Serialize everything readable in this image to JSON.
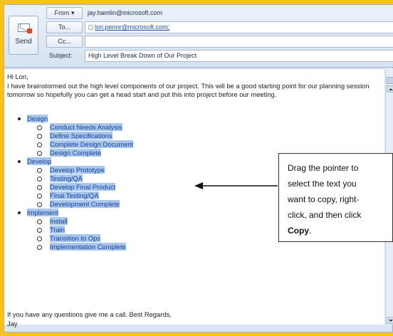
{
  "header": {
    "send_label": "Send",
    "from_label": "From ▾",
    "from_value": "jay.hamlin@microsoft.com",
    "to_label": "To...",
    "to_value": "lori.penor@microsoft.com;",
    "cc_label": "Cc...",
    "cc_value": "",
    "subject_label": "Subject:",
    "subject_value": "High Level Break Down of Our Project"
  },
  "message": {
    "greeting": "Hi Lori,",
    "intro": "I have brainstormed out the high level components of our project.  This will be a good starting point for our planning session tomorrow so hopefully you can get a head start and put this into project before our meeting.",
    "sections": [
      {
        "title": "Design",
        "items": [
          "Conduct Needs Analysis",
          "Define Specifications",
          "Complete Design Document",
          "Design Complete"
        ]
      },
      {
        "title": "Develop",
        "items": [
          "Develop Prototype",
          "Testing/QA",
          "Develop Final Product",
          "Final Testing/QA",
          "Development Complete"
        ]
      },
      {
        "title": "Implement",
        "items": [
          "Install",
          "Train",
          "Transition to Ops",
          "Implementation Complete"
        ]
      }
    ],
    "closing": "If you have any questions give me a call.  Best Regards,",
    "signature": "Jay"
  },
  "callout": {
    "line1": "Drag the pointer to",
    "line2": "select the text you",
    "line3": "want to copy, right-",
    "line4": "click, and then click",
    "bold": "Copy",
    "period": "."
  },
  "colors": {
    "selection": "#a7c8ec",
    "frame": "#f7c21c",
    "link": "#2350b8"
  }
}
